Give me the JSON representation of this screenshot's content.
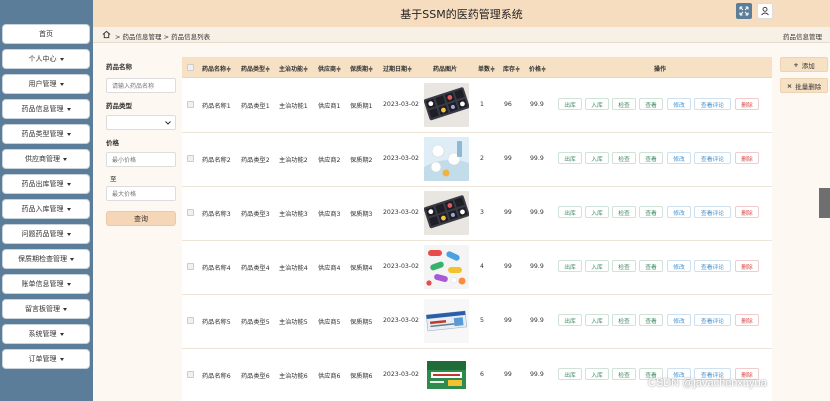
{
  "app": {
    "title": "基于SSM的医药管理系统"
  },
  "sidebar": {
    "items": [
      {
        "label": "首页",
        "caret": false
      },
      {
        "label": "个人中心",
        "caret": true
      },
      {
        "label": "用户管理",
        "caret": true
      },
      {
        "label": "药品信息管理",
        "caret": true
      },
      {
        "label": "药品类型管理",
        "caret": true
      },
      {
        "label": "供应商管理",
        "caret": true
      },
      {
        "label": "药品出库管理",
        "caret": true
      },
      {
        "label": "药品入库管理",
        "caret": true
      },
      {
        "label": "问题药品管理",
        "caret": true
      },
      {
        "label": "保质期检查管理",
        "caret": true
      },
      {
        "label": "账单信息管理",
        "caret": true
      },
      {
        "label": "留言板管理",
        "caret": true
      },
      {
        "label": "系统管理",
        "caret": true
      },
      {
        "label": "订单管理",
        "caret": true
      }
    ]
  },
  "breadcrumb": {
    "path": "> 药品信息管理 > 药品信息列表",
    "right": "药品信息管理"
  },
  "search": {
    "name_label": "药品名称",
    "name_placeholder": "请输入药品名称",
    "type_label": "药品类型",
    "type_value": "",
    "price_label": "价格",
    "min_placeholder": "最小价格",
    "to_label": "至",
    "max_placeholder": "最大价格",
    "button": "查询"
  },
  "table": {
    "headers": [
      "药品名称",
      "药品类型",
      "主治功能",
      "供应商",
      "保质期",
      "过期日期",
      "药品图片",
      "单数",
      "库存",
      "价格",
      "操作"
    ],
    "sort_mark": "≑",
    "rows": [
      {
        "name": "药品名称1",
        "type": "药品类型1",
        "func": "主治功能1",
        "supplier": "供应商1",
        "shelf": "保质期1",
        "expiry": "2023-03-02",
        "count": "1",
        "stock": "96",
        "price": "99.9",
        "img": "pillbox"
      },
      {
        "name": "药品名称2",
        "type": "药品类型2",
        "func": "主治功能2",
        "supplier": "供应商2",
        "shelf": "保质期2",
        "expiry": "2023-03-02",
        "count": "2",
        "stock": "99",
        "price": "99.9",
        "img": "tablets"
      },
      {
        "name": "药品名称3",
        "type": "药品类型3",
        "func": "主治功能3",
        "supplier": "供应商3",
        "shelf": "保质期3",
        "expiry": "2023-03-02",
        "count": "3",
        "stock": "99",
        "price": "99.9",
        "img": "pillbox"
      },
      {
        "name": "药品名称4",
        "type": "药品类型4",
        "func": "主治功能4",
        "supplier": "供应商4",
        "shelf": "保质期4",
        "expiry": "2023-03-02",
        "count": "4",
        "stock": "99",
        "price": "99.9",
        "img": "capsules"
      },
      {
        "name": "药品名称5",
        "type": "药品类型5",
        "func": "主治功能5",
        "supplier": "供应商5",
        "shelf": "保质期5",
        "expiry": "2023-03-02",
        "count": "5",
        "stock": "99",
        "price": "99.9",
        "img": "box"
      },
      {
        "name": "药品名称6",
        "type": "药品类型6",
        "func": "主治功能6",
        "supplier": "供应商6",
        "shelf": "保质期6",
        "expiry": "2023-03-02",
        "count": "6",
        "stock": "99",
        "price": "99.9",
        "img": "box2"
      }
    ],
    "actions": [
      "出库",
      "入库",
      "检查",
      "查看",
      "修改",
      "查看评论",
      "删除"
    ]
  },
  "right_actions": {
    "add": "添加",
    "batch_delete": "批量删除"
  },
  "watermark": "CSDN @javachenxuyua",
  "colors": {
    "sidebar": "#5b7d9a",
    "header": "#f7ddbf",
    "accent": "#f5d7b8",
    "delete": "#d64545"
  }
}
